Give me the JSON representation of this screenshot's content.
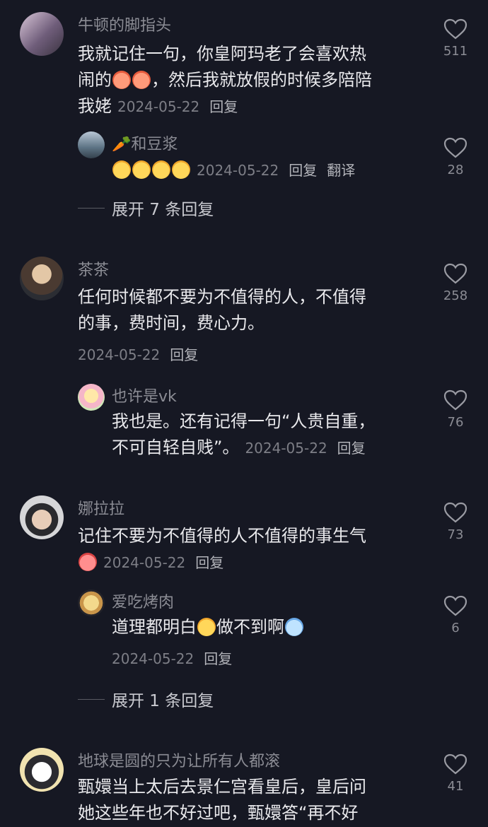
{
  "comments": [
    {
      "username": "牛顿的脚指头",
      "text_line1": "我就记住一句，你皇阿玛老了会喜欢热",
      "text_line2a": "闹的",
      "text_line2b": "，然后我就放假的时候多陪陪",
      "text_line3": "我姥",
      "date": "2024-05-22",
      "reply_label": "回复",
      "likes": "511"
    },
    {
      "username": "茶茶",
      "text_line1": "任何时候都不要为不值得的人，不值得",
      "text_line2": "的事，费时间，费心力。",
      "date": "2024-05-22",
      "reply_label": "回复",
      "likes": "258"
    },
    {
      "username": "娜拉拉",
      "text_line1": "记住不要为不值得的人不值得的事生气",
      "date": "2024-05-22",
      "reply_label": "回复",
      "likes": "73"
    },
    {
      "username": "地球是圆的只为让所有人都滚",
      "text_line1": "甄嬛当上太后去景仁宫看皇后，皇后问",
      "text_line2": "她这些年也不好过吧，甄嬛答“再不好",
      "likes": "41"
    }
  ],
  "replies": [
    {
      "username": "和豆浆",
      "date": "2024-05-22",
      "reply_label": "回复",
      "translate_label": "翻译",
      "likes": "28"
    },
    {
      "username": "也许是vk",
      "text_line1": "我也是。还有记得一句“人贵自重，",
      "text_line2": "不可自轻自贱”。",
      "date": "2024-05-22",
      "reply_label": "回复",
      "likes": "76"
    },
    {
      "username": "爱吃烤肉",
      "text_a": "道理都明白",
      "text_b": "做不到啊",
      "date": "2024-05-22",
      "reply_label": "回复",
      "likes": "6"
    }
  ],
  "expand": [
    {
      "label": "展开 7 条回复"
    },
    {
      "label": "展开 1 条回复"
    }
  ],
  "colors": {
    "background": "#161823",
    "username": "#8b8c94",
    "text": "#e9e9ec",
    "meta": "#7d7e86"
  },
  "icons": {
    "like": "heart-outline-icon",
    "carrot": "carrot-emoji-icon"
  }
}
